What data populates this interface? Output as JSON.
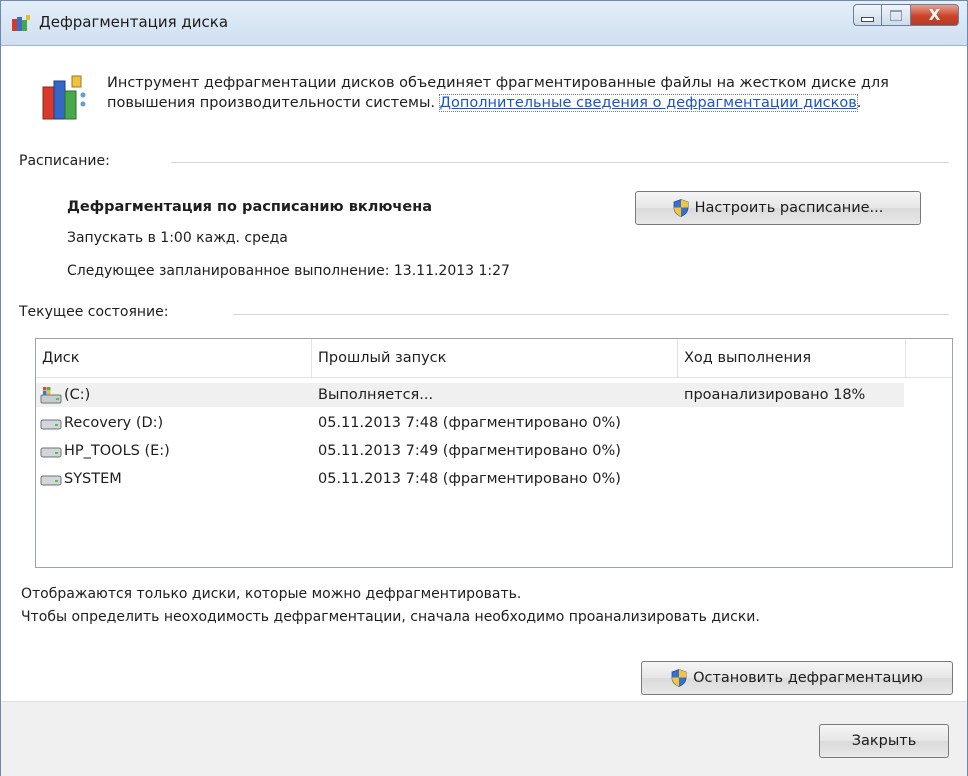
{
  "window": {
    "title": "Дефрагментация диска",
    "close_glyph": "X"
  },
  "intro": {
    "text": "Инструмент дефрагментации дисков объединяет фрагментированные файлы на жестком диске для повышения производительности системы. ",
    "link": "Дополнительные сведения о дефрагментации дисков",
    "suffix": "."
  },
  "schedule": {
    "section_label": "Расписание:",
    "status": "Дефрагментация по расписанию включена",
    "run_text": "Запускать в 1:00 кажд. среда",
    "next_run": "Следующее запланированное выполнение: 13.11.2013 1:27",
    "configure_button": "Настроить расписание..."
  },
  "current": {
    "section_label": "Текущее состояние:"
  },
  "disk_list": {
    "columns": [
      "Диск",
      "Прошлый запуск",
      "Ход выполнения"
    ],
    "rows": [
      {
        "disk": "(C:)",
        "last_run": "Выполняется...",
        "progress": "проанализировано 18%",
        "icon": "system-drive-icon",
        "selected": true
      },
      {
        "disk": "Recovery (D:)",
        "last_run": "05.11.2013 7:48 (фрагментировано 0%)",
        "progress": "",
        "icon": "drive-icon",
        "selected": false
      },
      {
        "disk": "HP_TOOLS (E:)",
        "last_run": "05.11.2013 7:49 (фрагментировано 0%)",
        "progress": "",
        "icon": "drive-icon",
        "selected": false
      },
      {
        "disk": "SYSTEM",
        "last_run": "05.11.2013 7:48 (фрагментировано 0%)",
        "progress": "",
        "icon": "drive-icon",
        "selected": false
      }
    ]
  },
  "info": {
    "line1": "Отображаются только диски, которые можно дефрагментировать.",
    "line2": "Чтобы определить неоходимость  дефрагментации, сначала необходимо проанализировать диски."
  },
  "actions": {
    "stop_button": "Остановить дефрагментацию",
    "close_button": "Закрыть"
  },
  "colors": {
    "link": "#1a55c5",
    "close_button": "#c9452c",
    "selection": "#f0f0f0"
  }
}
